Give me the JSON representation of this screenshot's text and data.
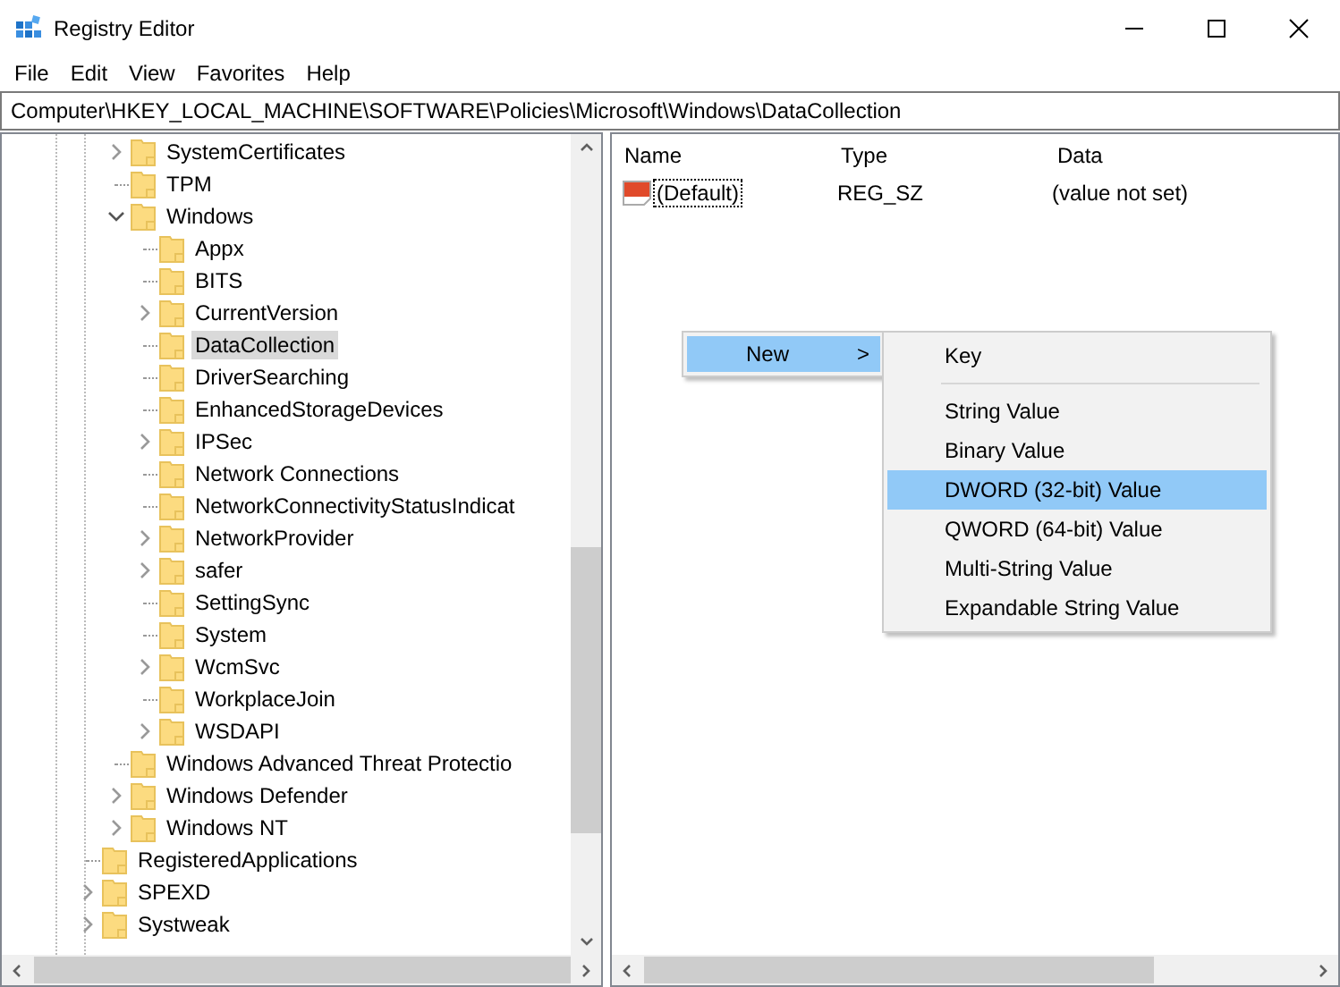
{
  "window": {
    "title": "Registry Editor"
  },
  "menu_bar": [
    "File",
    "Edit",
    "View",
    "Favorites",
    "Help"
  ],
  "address_bar": {
    "value": "Computer\\HKEY_LOCAL_MACHINE\\SOFTWARE\\Policies\\Microsoft\\Windows\\DataCollection"
  },
  "tree": {
    "items": [
      {
        "children": [
          {
            "label": "SystemCertificates",
            "expanded": false,
            "selected": false
          },
          {
            "label": "TPM",
            "selected": false
          },
          {
            "label": "Windows",
            "expanded": true,
            "selected": false,
            "children": [
              {
                "label": "Appx",
                "selected": false
              },
              {
                "label": "BITS",
                "selected": false
              },
              {
                "label": "CurrentVersion",
                "expanded": false,
                "selected": false
              },
              {
                "label": "DataCollection",
                "selected": true
              },
              {
                "label": "DriverSearching",
                "selected": false
              },
              {
                "label": "EnhancedStorageDevices",
                "selected": false
              },
              {
                "label": "IPSec",
                "expanded": false,
                "selected": false
              },
              {
                "label": "Network Connections",
                "selected": false
              },
              {
                "label": "NetworkConnectivityStatusIndicat",
                "selected": false
              },
              {
                "label": "NetworkProvider",
                "expanded": false,
                "selected": false
              },
              {
                "label": "safer",
                "expanded": false,
                "selected": false
              },
              {
                "label": "SettingSync",
                "selected": false
              },
              {
                "label": "System",
                "selected": false
              },
              {
                "label": "WcmSvc",
                "expanded": false,
                "selected": false
              },
              {
                "label": "WorkplaceJoin",
                "selected": false
              },
              {
                "label": "WSDAPI",
                "expanded": false,
                "selected": false
              }
            ]
          },
          {
            "label": "Windows Advanced Threat Protectio",
            "selected": false
          },
          {
            "label": "Windows Defender",
            "expanded": false,
            "selected": false
          },
          {
            "label": "Windows NT",
            "expanded": false,
            "selected": false
          }
        ]
      },
      {
        "label": "RegisteredApplications",
        "selected": false
      },
      {
        "label": "SPEXD",
        "expanded": false,
        "selected": false
      },
      {
        "label": "Systweak",
        "expanded": false,
        "selected": false
      }
    ]
  },
  "values": {
    "columns": [
      "Name",
      "Type",
      "Data"
    ],
    "rows": [
      {
        "name": "(Default)",
        "type": "REG_SZ",
        "data": "(value not set)",
        "focused": true
      }
    ]
  },
  "context_menu": {
    "items": [
      {
        "label": "New",
        "selected": true,
        "arrow": ">"
      }
    ],
    "submenu": [
      {
        "kind": "item",
        "label": "Key",
        "selected": false
      },
      {
        "kind": "separator"
      },
      {
        "kind": "item",
        "label": "String Value",
        "selected": false
      },
      {
        "kind": "item",
        "label": "Binary Value",
        "selected": false
      },
      {
        "kind": "item",
        "label": "DWORD (32-bit) Value",
        "selected": true
      },
      {
        "kind": "item",
        "label": "QWORD (64-bit) Value",
        "selected": false
      },
      {
        "kind": "item",
        "label": "Multi-String Value",
        "selected": false
      },
      {
        "kind": "item",
        "label": "Expandable String Value",
        "selected": false
      }
    ]
  }
}
